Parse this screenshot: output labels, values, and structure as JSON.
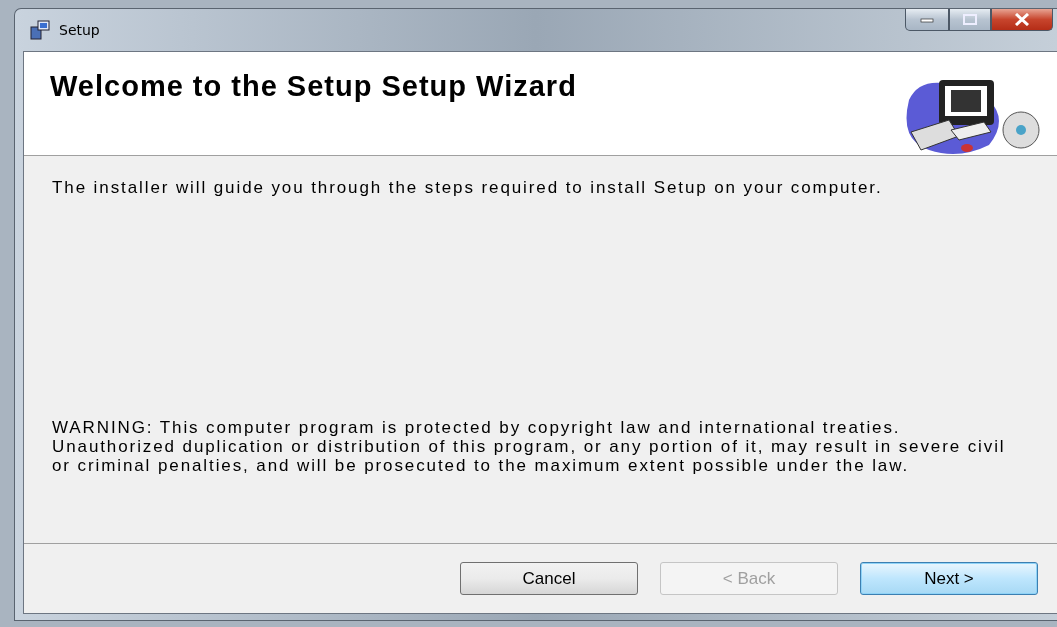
{
  "window": {
    "title": "Setup"
  },
  "header": {
    "title": "Welcome to the Setup Setup Wizard"
  },
  "intro": "The installer will guide you through the steps required to install Setup on your computer.",
  "warning": "WARNING: This computer program is protected by copyright law and international treaties. Unauthorized duplication or distribution of this program, or any portion of it, may result in severe civil or criminal penalties, and will be prosecuted to the maximum extent possible under the law.",
  "buttons": [
    {
      "label": "Cancel",
      "disabled": false,
      "default": false
    },
    {
      "label": "< Back",
      "disabled": true,
      "default": false
    },
    {
      "label": "Next >",
      "disabled": false,
      "default": true
    }
  ]
}
